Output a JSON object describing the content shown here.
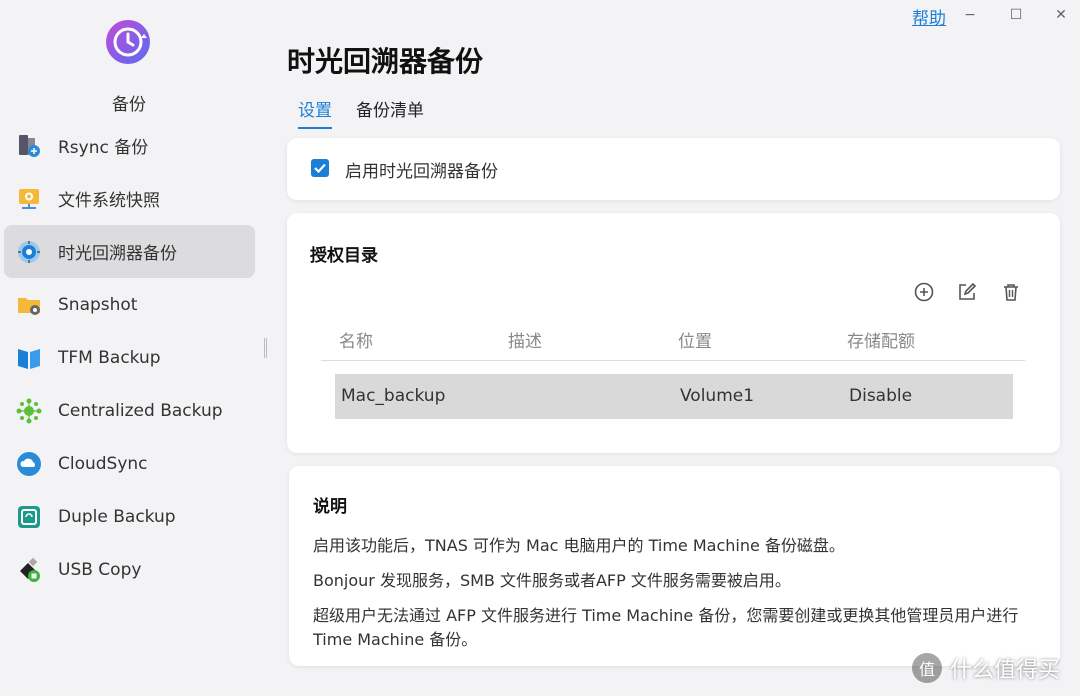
{
  "window": {
    "help_label": "帮助",
    "minimize_glyph": "−",
    "maximize_glyph": "☐",
    "close_glyph": "✕"
  },
  "sidebar": {
    "app_name": "备份",
    "items": [
      {
        "label": "Rsync 备份",
        "icon": "rsync-server-icon",
        "active": false
      },
      {
        "label": "文件系统快照",
        "icon": "filesystem-snapshot-icon",
        "active": false
      },
      {
        "label": "时光回溯器备份",
        "icon": "time-machine-icon",
        "active": true
      },
      {
        "label": "Snapshot",
        "icon": "snapshot-folder-icon",
        "active": false
      },
      {
        "label": "TFM Backup",
        "icon": "tfm-backup-icon",
        "active": false
      },
      {
        "label": "Centralized Backup",
        "icon": "centralized-backup-icon",
        "active": false
      },
      {
        "label": "CloudSync",
        "icon": "cloudsync-icon",
        "active": false
      },
      {
        "label": "Duple Backup",
        "icon": "duple-backup-icon",
        "active": false
      },
      {
        "label": "USB Copy",
        "icon": "usb-copy-icon",
        "active": false
      }
    ]
  },
  "main": {
    "title": "时光回溯器备份",
    "tabs": [
      {
        "label": "设置",
        "active": true
      },
      {
        "label": "备份清单",
        "active": false
      }
    ],
    "enable_checkbox": {
      "label": "启用时光回溯器备份",
      "checked": true
    },
    "authorized_dirs": {
      "title": "授权目录",
      "toolbar": [
        "add-icon",
        "edit-icon",
        "delete-icon"
      ],
      "columns": [
        "名称",
        "描述",
        "位置",
        "存储配额"
      ],
      "rows": [
        {
          "name": "Mac_backup",
          "description": "",
          "location": "Volume1",
          "quota": "Disable"
        }
      ]
    },
    "description": {
      "title": "说明",
      "lines": [
        "启用该功能后，TNAS 可作为 Mac 电脑用户的 Time Machine 备份磁盘。",
        "Bonjour 发现服务，SMB 文件服务或者AFP 文件服务需要被启用。",
        "超级用户无法通过 AFP 文件服务进行 Time Machine 备份，您需要创建或更换其他管理员用户进行 Time Machine 备份。"
      ]
    }
  },
  "watermark": {
    "text": "什么值得买",
    "badge": "值"
  },
  "colors": {
    "accent": "#1a7fd6",
    "active_nav_bg": "#dcdcde",
    "row_selected_bg": "#d9d9d9"
  }
}
